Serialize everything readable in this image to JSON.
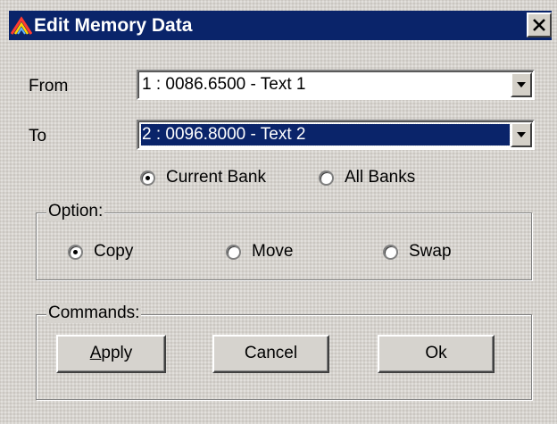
{
  "window": {
    "title": "Edit Memory Data",
    "app_icon": "mountain-peaks-icon",
    "close_icon": "close-icon"
  },
  "from": {
    "label": "From",
    "value": "1 : 0086.6500 - Text 1"
  },
  "to": {
    "label": "To",
    "value": "2 : 0096.8000 - Text 2"
  },
  "bank_scope": {
    "options": [
      {
        "label": "Current Bank",
        "checked": true
      },
      {
        "label": "All Banks",
        "checked": false
      }
    ]
  },
  "option_group": {
    "title": "Option:",
    "options": [
      {
        "label": "Copy",
        "checked": true
      },
      {
        "label": "Move",
        "checked": false
      },
      {
        "label": "Swap",
        "checked": false
      }
    ]
  },
  "commands": {
    "title": "Commands:",
    "apply_mnemonic": "A",
    "apply_rest": "pply",
    "cancel_label": "Cancel",
    "ok_label": "Ok"
  },
  "colors": {
    "titlebar": "#0a246a",
    "face": "#d6d3ce",
    "selection": "#0a246a"
  }
}
